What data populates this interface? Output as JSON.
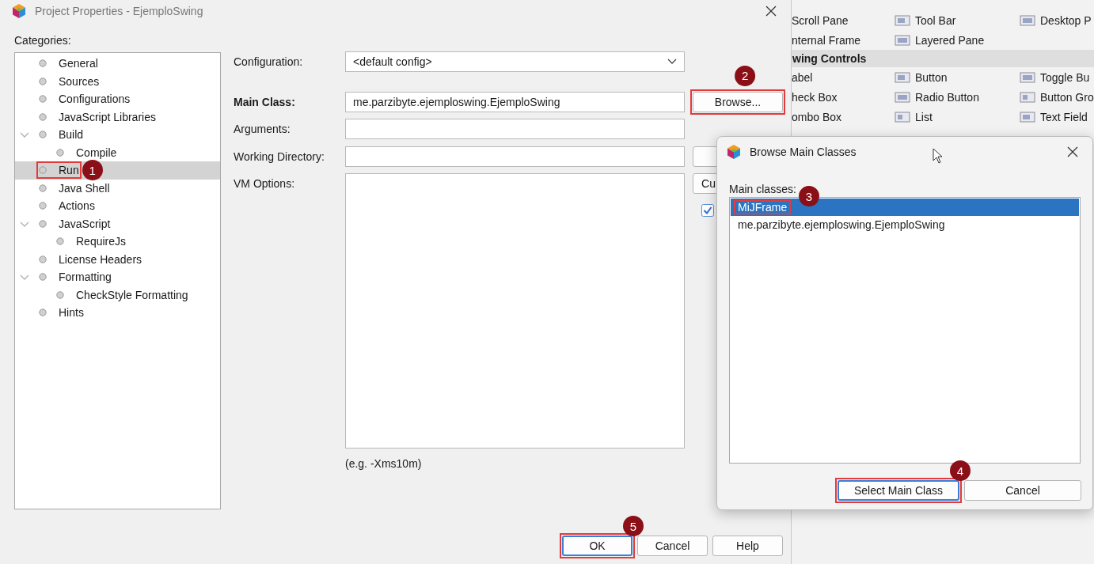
{
  "palette": {
    "items": [
      {
        "kind": "row",
        "cells": [
          "Scroll Pane",
          "Tool Bar",
          "Desktop P"
        ]
      },
      {
        "kind": "row",
        "cells": [
          "nternal Frame",
          "Layered Pane"
        ]
      },
      {
        "kind": "header",
        "label": "wing Controls"
      },
      {
        "kind": "row",
        "cells": [
          "abel",
          "Button",
          "Toggle Bu"
        ]
      },
      {
        "kind": "row",
        "cells": [
          "heck Box",
          "Radio Button",
          "Button Gro"
        ]
      },
      {
        "kind": "row",
        "cells": [
          "ombo Box",
          "List",
          "Text Field"
        ]
      }
    ]
  },
  "dialog": {
    "title": "Project Properties - EjemploSwing",
    "categories_label": "Categories:",
    "categories": [
      {
        "label": "General",
        "selected": false
      },
      {
        "label": "Sources",
        "selected": false
      },
      {
        "label": "Configurations",
        "selected": false
      },
      {
        "label": "JavaScript Libraries",
        "selected": false
      },
      {
        "label": "Build",
        "selected": false,
        "expanded": true,
        "children": [
          {
            "label": "Compile",
            "selected": false
          }
        ]
      },
      {
        "label": "Run",
        "selected": true,
        "annotation": "1"
      },
      {
        "label": "Java Shell",
        "selected": false
      },
      {
        "label": "Actions",
        "selected": false
      },
      {
        "label": "JavaScript",
        "selected": false,
        "expanded": true,
        "children": [
          {
            "label": "RequireJs",
            "selected": false
          }
        ]
      },
      {
        "label": "License Headers",
        "selected": false
      },
      {
        "label": "Formatting",
        "selected": false,
        "expanded": true,
        "children": [
          {
            "label": "CheckStyle Formatting",
            "selected": false
          }
        ]
      },
      {
        "label": "Hints",
        "selected": false
      }
    ],
    "fields": [
      {
        "label": "Configuration:",
        "kind": "dropdown",
        "emphasized": false,
        "value": "<default config>"
      },
      {
        "label": "Main Class:",
        "kind": "text",
        "emphasized": true,
        "value": "me.parzibyte.ejemploswing.EjemploSwing",
        "side": [
          {
            "kind": "button",
            "label": "Browse...",
            "annotation": "2"
          }
        ]
      },
      {
        "label": "Arguments:",
        "kind": "text",
        "emphasized": false
      },
      {
        "label": "Working Directory:",
        "kind": "text",
        "emphasized": false,
        "side": [
          {
            "kind": "button"
          }
        ]
      },
      {
        "label": "VM Options:",
        "kind": "textarea",
        "emphasized": false,
        "side": [
          {
            "kind": "button",
            "label": "Cu"
          },
          {
            "kind": "checkbox",
            "checked": true
          }
        ]
      }
    ],
    "hint": "(e.g. -Xms10m)",
    "buttons": [
      {
        "label": "OK",
        "default": true,
        "annotation": "5"
      },
      {
        "label": "Cancel",
        "default": false
      },
      {
        "label": "Help",
        "default": false
      }
    ]
  },
  "browse_dialog": {
    "title": "Browse Main Classes",
    "list_label": "Main classes:",
    "items": [
      {
        "label": "MiJFrame",
        "selected": true,
        "annotation": "3"
      },
      {
        "label": "me.parzibyte.ejemploswing.EjemploSwing",
        "selected": false
      }
    ],
    "buttons": [
      {
        "label": "Select Main Class",
        "default": true,
        "annotation": "4"
      },
      {
        "label": "Cancel",
        "default": false
      }
    ]
  }
}
